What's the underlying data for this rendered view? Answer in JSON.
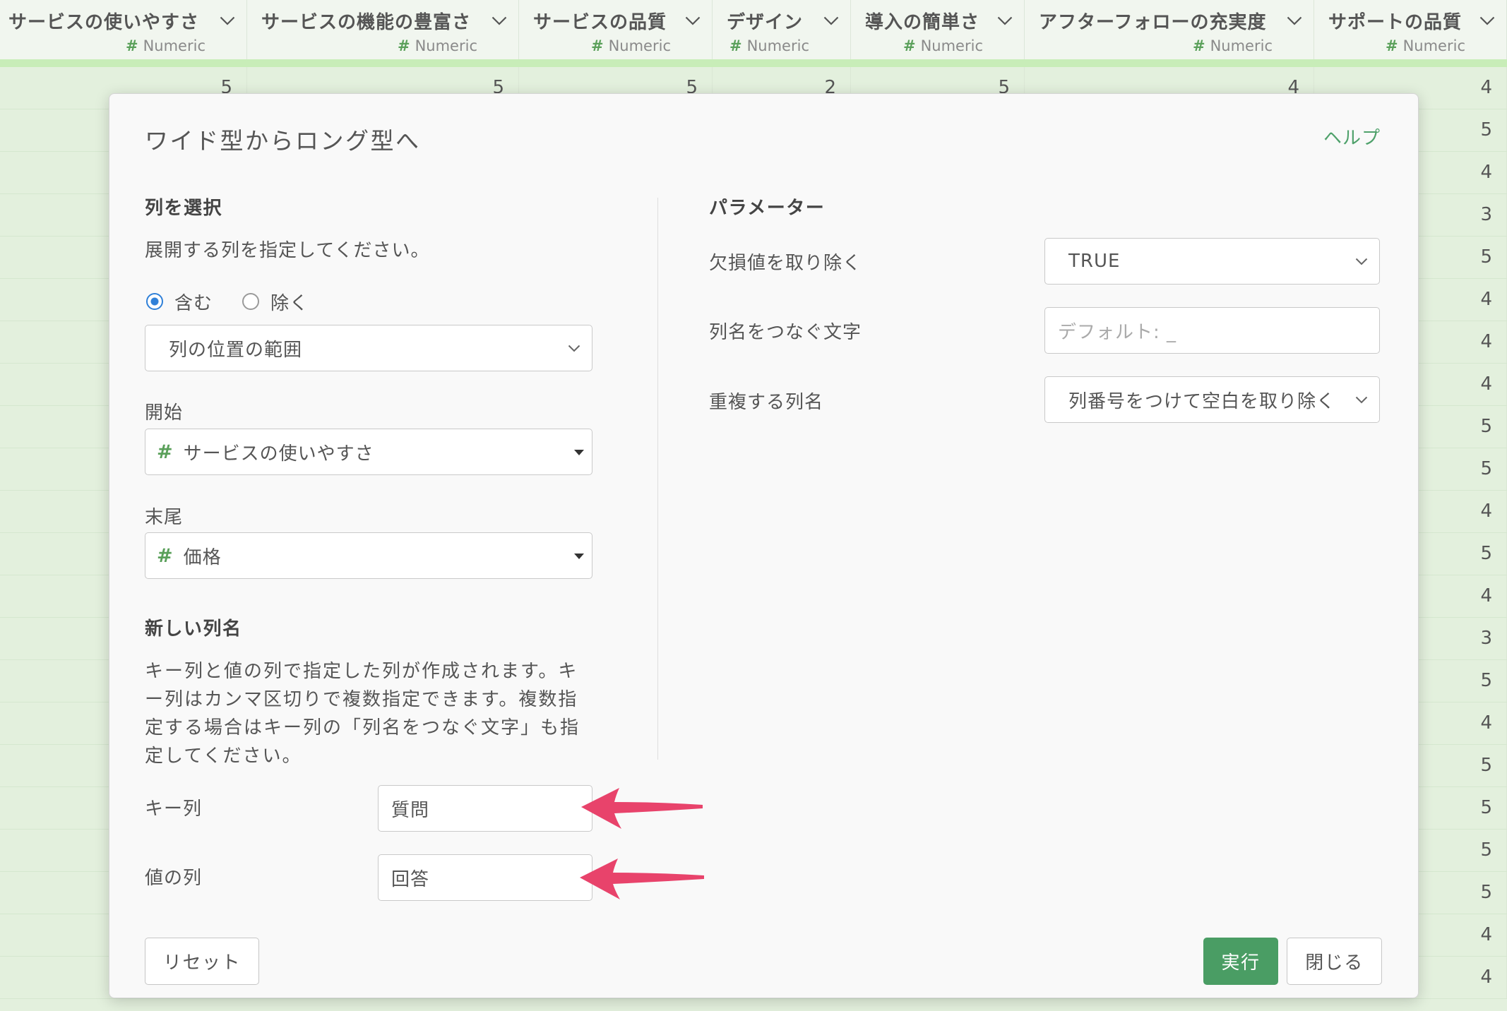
{
  "table": {
    "columns": [
      {
        "name": "サービスの使いやすさ",
        "type": "Numeric"
      },
      {
        "name": "サービスの機能の豊富さ",
        "type": "Numeric"
      },
      {
        "name": "サービスの品質",
        "type": "Numeric"
      },
      {
        "name": "デザイン",
        "type": "Numeric"
      },
      {
        "name": "導入の簡単さ",
        "type": "Numeric"
      },
      {
        "name": "アフターフォローの充実度",
        "type": "Numeric"
      },
      {
        "name": "サポートの品質",
        "type": "Numeric"
      }
    ],
    "rows": [
      [
        5,
        5,
        5,
        2,
        5,
        4,
        4
      ],
      [
        null,
        null,
        null,
        null,
        null,
        null,
        5
      ],
      [
        null,
        null,
        null,
        null,
        null,
        null,
        4
      ],
      [
        null,
        null,
        null,
        null,
        null,
        null,
        3
      ],
      [
        null,
        null,
        null,
        null,
        null,
        null,
        5
      ],
      [
        null,
        null,
        null,
        null,
        null,
        null,
        4
      ],
      [
        null,
        null,
        null,
        null,
        null,
        null,
        4
      ],
      [
        null,
        null,
        null,
        null,
        null,
        null,
        4
      ],
      [
        null,
        null,
        null,
        null,
        null,
        null,
        5
      ],
      [
        null,
        null,
        null,
        null,
        null,
        null,
        5
      ],
      [
        null,
        null,
        null,
        null,
        null,
        null,
        4
      ],
      [
        null,
        null,
        null,
        null,
        null,
        null,
        5
      ],
      [
        null,
        null,
        null,
        null,
        null,
        null,
        4
      ],
      [
        null,
        null,
        null,
        null,
        null,
        null,
        3
      ],
      [
        null,
        null,
        null,
        null,
        null,
        null,
        5
      ],
      [
        null,
        null,
        null,
        null,
        null,
        null,
        4
      ],
      [
        null,
        null,
        null,
        null,
        null,
        null,
        5
      ],
      [
        null,
        null,
        null,
        null,
        null,
        null,
        5
      ],
      [
        null,
        null,
        null,
        null,
        null,
        null,
        5
      ],
      [
        null,
        null,
        null,
        null,
        null,
        null,
        5
      ],
      [
        null,
        null,
        null,
        null,
        null,
        null,
        4
      ],
      [
        null,
        null,
        null,
        null,
        null,
        null,
        4
      ]
    ]
  },
  "dialog": {
    "title": "ワイド型からロング型へ",
    "help_link": "ヘルプ",
    "column_select": {
      "heading": "列を選択",
      "description": "展開する列を指定してください。",
      "mode_options": [
        {
          "label": "含む",
          "selected": true
        },
        {
          "label": "除く",
          "selected": false
        }
      ],
      "selection_method": "列の位置の範囲",
      "start_label": "開始",
      "start_value": "サービスの使いやすさ",
      "end_label": "末尾",
      "end_value": "価格"
    },
    "new_columns": {
      "heading": "新しい列名",
      "description": "キー列と値の列で指定した列が作成されます。キー列はカンマ区切りで複数指定できます。複数指定する場合はキー列の「列名をつなぐ文字」も指定してください。",
      "key_label": "キー列",
      "key_value": "質問",
      "value_label": "値の列",
      "value_value": "回答"
    },
    "parameters": {
      "heading": "パラメーター",
      "remove_na_label": "欠損値を取り除く",
      "remove_na_value": "TRUE",
      "separator_label": "列名をつなぐ文字",
      "separator_placeholder": "デフォルト: _",
      "duplicate_label": "重複する列名",
      "duplicate_value": "列番号をつけて空白を取り除く"
    },
    "buttons": {
      "reset": "リセット",
      "run": "実行",
      "close": "閉じる"
    }
  },
  "icons": {
    "column_menu": "chevron-down-icon",
    "column_type": "hash-icon",
    "select_arrow": "chevron-down-icon",
    "column_dropdown": "caret-down-icon",
    "annotation": "arrow-left-icon"
  },
  "colors": {
    "accent": "#4a9d64",
    "help_link": "#4fa16b",
    "type_icon": "#5aa05a",
    "radio_selected": "#2f80d8",
    "annotation_arrow": "#e8436b",
    "grid_background": "#e3f0dd",
    "header_underline": "#c8edb8"
  }
}
